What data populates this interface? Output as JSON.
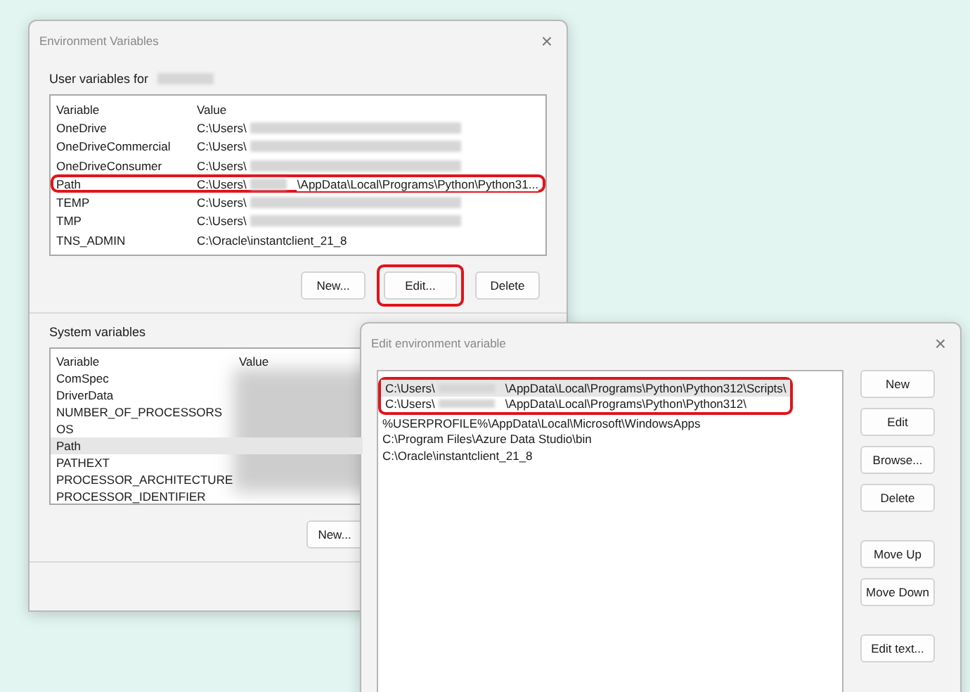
{
  "env_window": {
    "title": "Environment Variables",
    "close": "×",
    "user_section": {
      "label": "User variables for",
      "columns": [
        "Variable",
        "Value"
      ],
      "rows": [
        {
          "name": "OneDrive",
          "value": "C:\\Users\\",
          "redacted": true,
          "selected": false,
          "highlighted": false
        },
        {
          "name": "OneDriveCommercial",
          "value": "C:\\Users\\",
          "redacted": true,
          "selected": false,
          "highlighted": false
        },
        {
          "name": "OneDriveConsumer",
          "value": "C:\\Users\\",
          "redacted": true,
          "selected": false,
          "highlighted": false
        },
        {
          "name": "Path",
          "value": "C:\\Users\\",
          "redacted": true,
          "value_rest": "\\AppData\\Local\\Programs\\Python\\Python31...",
          "selected": false,
          "highlighted": true
        },
        {
          "name": "TEMP",
          "value": "C:\\Users\\",
          "redacted": true,
          "selected": false,
          "highlighted": false
        },
        {
          "name": "TMP",
          "value": "C:\\Users\\",
          "redacted": true,
          "selected": false,
          "highlighted": false
        },
        {
          "name": "TNS_ADMIN",
          "value": "C:\\Oracle\\instantclient_21_8",
          "redacted": false,
          "selected": false,
          "highlighted": false
        }
      ],
      "buttons": [
        {
          "label": "New...",
          "highlighted": false
        },
        {
          "label": "Edit...",
          "highlighted": true
        },
        {
          "label": "Delete",
          "highlighted": false
        }
      ]
    },
    "system_section": {
      "label": "System variables",
      "columns": [
        "Variable",
        "Value"
      ],
      "rows": [
        {
          "name": "ComSpec",
          "selected": false
        },
        {
          "name": "DriverData",
          "selected": false
        },
        {
          "name": "NUMBER_OF_PROCESSORS",
          "selected": false
        },
        {
          "name": "OS",
          "selected": false
        },
        {
          "name": "Path",
          "selected": true
        },
        {
          "name": "PATHEXT",
          "selected": false
        },
        {
          "name": "PROCESSOR_ARCHITECTURE",
          "selected": false
        },
        {
          "name": "PROCESSOR_IDENTIFIER",
          "selected": false
        }
      ],
      "buttons": [
        {
          "label": "New..."
        }
      ]
    }
  },
  "edit_window": {
    "title": "Edit environment variable",
    "close": "×",
    "entries": [
      {
        "text": "C:\\Users\\",
        "redacted": true,
        "text_rest": "\\AppData\\Local\\Programs\\Python\\Python312\\Scripts\\",
        "selected": true,
        "highlighted": true
      },
      {
        "text": "C:\\Users\\",
        "redacted": true,
        "text_rest": "\\AppData\\Local\\Programs\\Python\\Python312\\",
        "selected": false,
        "highlighted": true
      },
      {
        "text": "%USERPROFILE%\\AppData\\Local\\Microsoft\\WindowsApps",
        "redacted": false,
        "selected": false,
        "highlighted": false
      },
      {
        "text": "C:\\Program Files\\Azure Data Studio\\bin",
        "redacted": false,
        "selected": false,
        "highlighted": false
      },
      {
        "text": "C:\\Oracle\\instantclient_21_8",
        "redacted": false,
        "selected": false,
        "highlighted": false
      }
    ],
    "buttons": [
      {
        "label": "New"
      },
      {
        "label": "Edit"
      },
      {
        "label": "Browse..."
      },
      {
        "label": "Delete"
      },
      {
        "label": "Move Up"
      },
      {
        "label": "Move Down"
      },
      {
        "label": "Edit text..."
      }
    ]
  }
}
